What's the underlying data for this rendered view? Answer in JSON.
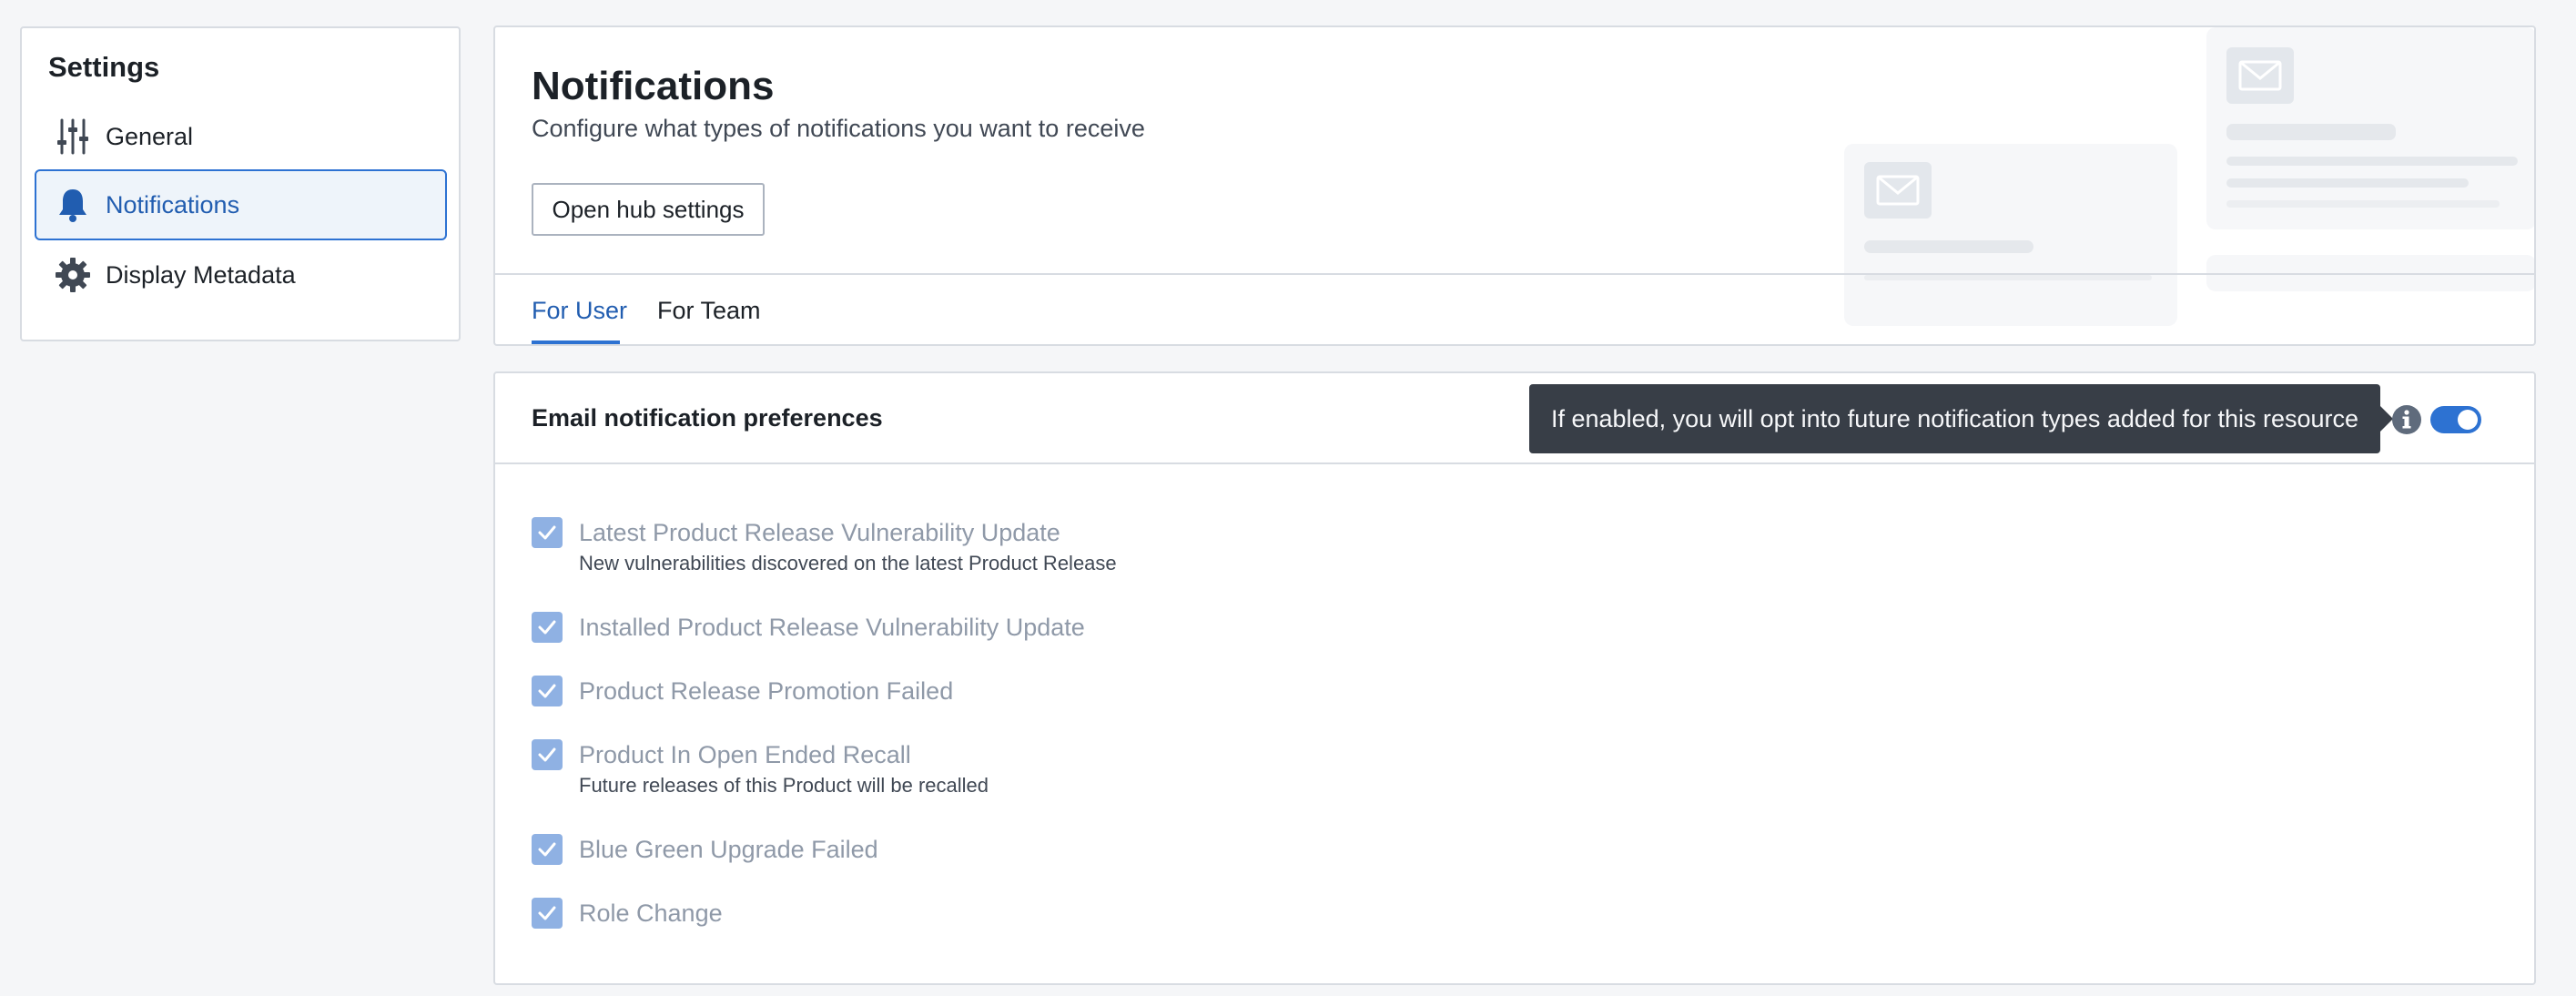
{
  "sidebar": {
    "title": "Settings",
    "items": [
      {
        "label": "General",
        "icon": "sliders-icon",
        "active": false
      },
      {
        "label": "Notifications",
        "icon": "bell-icon",
        "active": true
      },
      {
        "label": "Display Metadata",
        "icon": "gear-icon",
        "active": false
      }
    ]
  },
  "header": {
    "title": "Notifications",
    "subtitle": "Configure what types of notifications you want to receive",
    "hub_button_label": "Open hub settings",
    "tabs": [
      {
        "label": "For User",
        "selected": true
      },
      {
        "label": "For Team",
        "selected": false
      }
    ]
  },
  "preferences": {
    "title": "Email notification preferences",
    "tooltip": "If enabled, you will opt into future notification types added for this resource",
    "toggle_enabled": true,
    "items": [
      {
        "label": "Latest Product Release Vulnerability Update",
        "description": "New vulnerabilities discovered on the latest Product Release",
        "checked": true
      },
      {
        "label": "Installed Product Release Vulnerability Update",
        "description": "",
        "checked": true
      },
      {
        "label": "Product Release Promotion Failed",
        "description": "",
        "checked": true
      },
      {
        "label": "Product In Open Ended Recall",
        "description": "Future releases of this Product will be recalled",
        "checked": true
      },
      {
        "label": "Blue Green Upgrade Failed",
        "description": "",
        "checked": true
      },
      {
        "label": "Role Change",
        "description": "",
        "checked": true
      }
    ]
  },
  "colors": {
    "accent": "#2d72d2",
    "active_text": "#215db0",
    "checkbox_disabled": "#8fb1e3",
    "tooltip_bg": "#383e47"
  }
}
